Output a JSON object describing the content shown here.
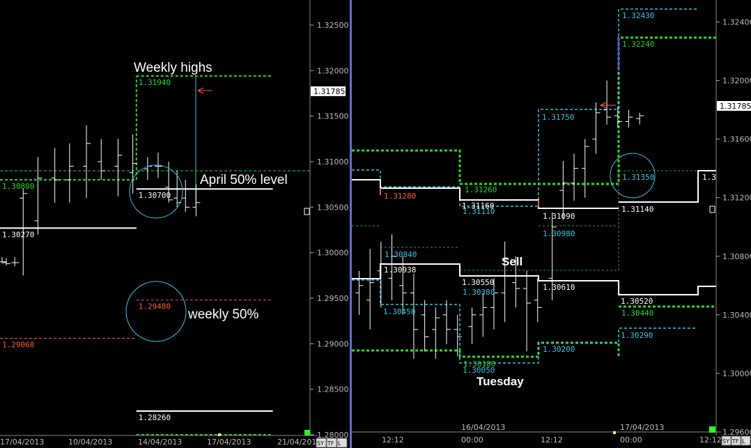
{
  "colors": {
    "bg": "#000000",
    "axis": "#ffffff",
    "white": "#ffffff",
    "green": "#22dd22",
    "cyan": "#2ec8e8",
    "red": "#ff5a3c",
    "blue": "#5555ff",
    "darkgreen": "#2f9a2f",
    "grey": "#bbbbbb",
    "divider": "#6a6ad6",
    "marker": "#22ff22"
  },
  "chart_data": [
    {
      "type": "line",
      "title": "",
      "ylim": [
        1.28,
        1.327
      ],
      "y_ticks": [
        "1.32500",
        "1.32000",
        "1.31500",
        "1.31000",
        "1.30500",
        "1.30000",
        "1.29500",
        "1.29000",
        "1.28500",
        "1.28000"
      ],
      "x_ticks": [
        "17/04/2013",
        "10/04/2013",
        "14/04/2013",
        "17/04/2013",
        "21/04/2013"
      ],
      "last_price": "1.31785",
      "corner_buttons": [
        "SY",
        "TF",
        "L"
      ],
      "ohlc_bars": [
        {
          "x": 0.01,
          "h": 1.2995,
          "l": 1.2988,
          "o": 1.299,
          "c": 1.299
        },
        {
          "x": 0.03,
          "h": 1.2994,
          "l": 1.2986,
          "o": 1.2989,
          "c": 1.2988
        },
        {
          "x": 0.07,
          "h": 1.2995,
          "l": 1.2985,
          "o": 1.2989,
          "c": 1.2989
        },
        {
          "x": 0.11,
          "h": 1.307,
          "l": 1.2975,
          "o": 1.306,
          "c": 1.3065
        },
        {
          "x": 0.18,
          "h": 1.3105,
          "l": 1.302,
          "o": 1.3035,
          "c": 1.3082
        },
        {
          "x": 0.26,
          "h": 1.3115,
          "l": 1.3055,
          "o": 1.3082,
          "c": 1.308
        },
        {
          "x": 0.33,
          "h": 1.312,
          "l": 1.3055,
          "o": 1.308,
          "c": 1.3095
        },
        {
          "x": 0.41,
          "h": 1.314,
          "l": 1.306,
          "o": 1.3095,
          "c": 1.312
        },
        {
          "x": 0.48,
          "h": 1.3125,
          "l": 1.308,
          "o": 1.31,
          "c": 1.309
        },
        {
          "x": 0.56,
          "h": 1.3125,
          "l": 1.3062,
          "o": 1.3095,
          "c": 1.3107
        },
        {
          "x": 0.63,
          "h": 1.313,
          "l": 1.3065,
          "o": 1.3088,
          "c": 1.3098
        },
        {
          "x": 0.7,
          "h": 1.3105,
          "l": 1.308,
          "o": 1.3092,
          "c": 1.3095
        },
        {
          "x": 0.75,
          "h": 1.311,
          "l": 1.3082,
          "o": 1.3095,
          "c": 1.3095
        },
        {
          "x": 0.8,
          "h": 1.31,
          "l": 1.3055,
          "o": 1.3072,
          "c": 1.3058
        },
        {
          "x": 0.84,
          "h": 1.309,
          "l": 1.305,
          "o": 1.306,
          "c": 1.3055
        },
        {
          "x": 0.88,
          "h": 1.308,
          "l": 1.3045,
          "o": 1.306,
          "c": 1.305
        },
        {
          "x": 0.93,
          "h": 1.3075,
          "l": 1.304,
          "o": 1.305,
          "c": 1.3055
        }
      ],
      "levels": [
        {
          "label": "1.31940",
          "y": 1.3194,
          "x0": 0.44,
          "x1": 0.88,
          "color": "green",
          "style": "dash",
          "width": 2
        },
        {
          "label": "1.30800",
          "y": 1.308,
          "x0": 0.0,
          "x1": 0.44,
          "color": "green",
          "style": "dash",
          "width": 2
        },
        {
          "label": "",
          "y": 1.309,
          "x0": 0.0,
          "x1": 1.0,
          "color": "green",
          "style": "dash",
          "width": 1
        },
        {
          "label": "1.30700",
          "y": 1.307,
          "x0": 0.44,
          "x1": 0.88,
          "color": "white",
          "style": "solid",
          "width": 2
        },
        {
          "label": "1.30270",
          "y": 1.3027,
          "x0": 0.0,
          "x1": 0.44,
          "color": "white",
          "style": "solid",
          "width": 2
        },
        {
          "label": "1.29480",
          "y": 1.2948,
          "x0": 0.44,
          "x1": 0.88,
          "color": "red",
          "style": "dash",
          "width": 1
        },
        {
          "label": "1.29060",
          "y": 1.2906,
          "x0": 0.0,
          "x1": 0.44,
          "color": "red",
          "style": "dash",
          "width": 1
        },
        {
          "label": "1.28260",
          "y": 1.2826,
          "x0": 0.44,
          "x1": 0.88,
          "color": "white",
          "style": "solid",
          "width": 2
        },
        {
          "label": "",
          "y": 1.28,
          "x0": 0.44,
          "x1": 0.88,
          "color": "green",
          "style": "dash",
          "width": 2
        }
      ],
      "annotations": [
        "Weekly highs",
        "April 50% level",
        "weekly 50%"
      ]
    },
    {
      "type": "line",
      "title": "",
      "ylim": [
        1.296,
        1.3255
      ],
      "y_ticks": [
        "1.32400",
        "1.32000",
        "1.31600",
        "1.31200",
        "1.30800",
        "1.30400",
        "1.30000",
        "1.29600"
      ],
      "x_ticks": [
        "12:12",
        "00:00",
        "12:12",
        "00:00",
        "12:12"
      ],
      "date_labels": [
        "16/04/2013",
        "17/04/2013"
      ],
      "last_price": "1.31785",
      "partial_label": "1.3",
      "corner_buttons": [
        "SY",
        "TF",
        "L"
      ],
      "ohlc_bars": [
        {
          "x": 0.02,
          "h": 1.307,
          "l": 1.304,
          "o": 1.3055,
          "c": 1.306
        },
        {
          "x": 0.05,
          "h": 1.3085,
          "l": 1.303,
          "o": 1.305,
          "c": 1.3062
        },
        {
          "x": 0.08,
          "h": 1.309,
          "l": 1.3045,
          "o": 1.307,
          "c": 1.3075
        },
        {
          "x": 0.11,
          "h": 1.3095,
          "l": 1.305,
          "o": 1.3065,
          "c": 1.308
        },
        {
          "x": 0.14,
          "h": 1.308,
          "l": 1.304,
          "o": 1.306,
          "c": 1.3055
        },
        {
          "x": 0.17,
          "h": 1.3068,
          "l": 1.301,
          "o": 1.3055,
          "c": 1.303
        },
        {
          "x": 0.2,
          "h": 1.305,
          "l": 1.3015,
          "o": 1.304,
          "c": 1.3025
        },
        {
          "x": 0.23,
          "h": 1.3045,
          "l": 1.301,
          "o": 1.303,
          "c": 1.3038
        },
        {
          "x": 0.26,
          "h": 1.305,
          "l": 1.302,
          "o": 1.304,
          "c": 1.303
        },
        {
          "x": 0.29,
          "h": 1.304,
          "l": 1.3012,
          "o": 1.303,
          "c": 1.3025
        },
        {
          "x": 0.33,
          "h": 1.3045,
          "l": 1.302,
          "o": 1.3032,
          "c": 1.304
        },
        {
          "x": 0.36,
          "h": 1.3055,
          "l": 1.3025,
          "o": 1.304,
          "c": 1.3045
        },
        {
          "x": 0.39,
          "h": 1.3065,
          "l": 1.303,
          "o": 1.3045,
          "c": 1.3055
        },
        {
          "x": 0.42,
          "h": 1.309,
          "l": 1.3035,
          "o": 1.3055,
          "c": 1.3078
        },
        {
          "x": 0.45,
          "h": 1.308,
          "l": 1.3045,
          "o": 1.3062,
          "c": 1.3058
        },
        {
          "x": 0.48,
          "h": 1.307,
          "l": 1.3015,
          "o": 1.3058,
          "c": 1.3048
        },
        {
          "x": 0.51,
          "h": 1.3065,
          "l": 1.3035,
          "o": 1.305,
          "c": 1.3045
        },
        {
          "x": 0.55,
          "h": 1.311,
          "l": 1.305,
          "o": 1.3065,
          "c": 1.31
        },
        {
          "x": 0.58,
          "h": 1.3145,
          "l": 1.3105,
          "o": 1.3125,
          "c": 1.313
        },
        {
          "x": 0.61,
          "h": 1.315,
          "l": 1.3118,
          "o": 1.313,
          "c": 1.314
        },
        {
          "x": 0.64,
          "h": 1.316,
          "l": 1.312,
          "o": 1.314,
          "c": 1.3155
        },
        {
          "x": 0.67,
          "h": 1.3185,
          "l": 1.315,
          "o": 1.316,
          "c": 1.3178
        },
        {
          "x": 0.7,
          "h": 1.32,
          "l": 1.317,
          "o": 1.318,
          "c": 1.3175
        },
        {
          "x": 0.73,
          "h": 1.3182,
          "l": 1.3168,
          "o": 1.3176,
          "c": 1.3172
        },
        {
          "x": 0.76,
          "h": 1.318,
          "l": 1.3168,
          "o": 1.3172,
          "c": 1.3175
        },
        {
          "x": 0.79,
          "h": 1.3178,
          "l": 1.317,
          "o": 1.3174,
          "c": 1.3176
        }
      ],
      "annotations": [
        "Sell",
        "Tuesday"
      ],
      "level_labels": [
        {
          "label": "1.32430",
          "y": 1.3243,
          "color": "cyan"
        },
        {
          "label": "1.32240",
          "y": 1.3224,
          "color": "green"
        },
        {
          "label": "1.31750",
          "y": 1.317,
          "color": "cyan"
        },
        {
          "label": "1.31350",
          "y": 1.3124,
          "color": "cyan"
        },
        {
          "label": "1.31260",
          "y": 1.3123,
          "color": "green"
        },
        {
          "label": "1.31280",
          "y": 1.312,
          "color": "red"
        },
        {
          "label": "1.31160",
          "y": 1.311,
          "color": "white"
        },
        {
          "label": "1.31110",
          "y": 1.3104,
          "color": "cyan"
        },
        {
          "label": "1.31090",
          "y": 1.3099,
          "color": "white"
        },
        {
          "label": "1.31140",
          "y": 1.3102,
          "color": "white"
        },
        {
          "label": "1.30980",
          "y": 1.3086,
          "color": "cyan"
        },
        {
          "label": "1.30840",
          "y": 1.3075,
          "color": "cyan"
        },
        {
          "label": "1.30938",
          "y": 1.3066,
          "color": "white"
        },
        {
          "label": "1.30550",
          "y": 1.3058,
          "color": "white"
        },
        {
          "label": "1.30380",
          "y": 1.305,
          "color": "cyan"
        },
        {
          "label": "1.30610",
          "y": 1.3055,
          "color": "white"
        },
        {
          "label": "1.30520",
          "y": 1.3043,
          "color": "white"
        },
        {
          "label": "1.30450",
          "y": 1.3037,
          "color": "cyan"
        },
        {
          "label": "1.30440",
          "y": 1.3037,
          "color": "green"
        },
        {
          "label": "1.30290",
          "y": 1.303,
          "color": "cyan"
        },
        {
          "label": "1.30200",
          "y": 1.3018,
          "color": "cyan"
        },
        {
          "label": "1.30180",
          "y": 1.3,
          "color": "green"
        },
        {
          "label": "1.30050",
          "y": 1.2995,
          "color": "cyan"
        }
      ]
    }
  ]
}
